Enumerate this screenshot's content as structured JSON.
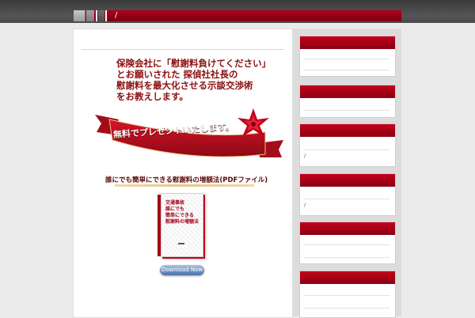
{
  "nav": {
    "breadcrumb": "/"
  },
  "main": {
    "headline_lines": [
      "保険会社に「慰謝料負けてください」",
      "とお願いされた 探偵社社長の",
      "慰謝料を最大化させる示談交渉術",
      "をお教えします。"
    ],
    "ribbon_text": "無料でプレゼントいたします。",
    "pdf_title": "誰にでも簡単にできる慰謝料の増額法(PDFファイル)",
    "book_lines": [
      "交通事故",
      "誰にでも",
      "簡単にできる",
      "慰謝料の増額法"
    ],
    "download_label": "Download Now"
  },
  "sidebar": {
    "widget_marks": [
      "/",
      "/"
    ]
  }
}
